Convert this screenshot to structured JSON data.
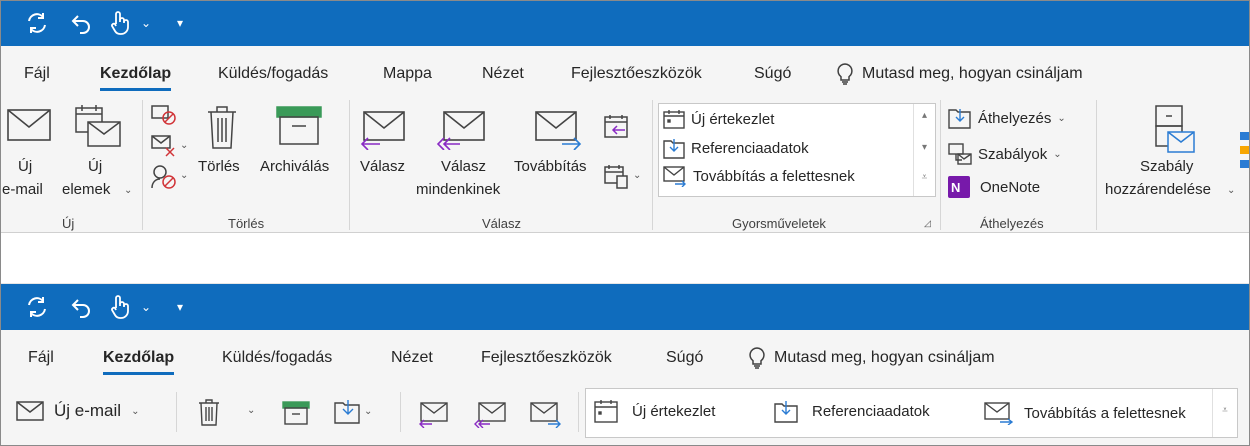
{
  "colors": {
    "brand": "#0f6cbd",
    "purple": "#8a2bc4",
    "blue": "#2b7cd3",
    "red": "#d13438",
    "green": "#3a9a58"
  },
  "top": {
    "qat": {
      "icons": [
        "sync-icon",
        "undo-icon",
        "touch-mode-icon",
        "customize-qat-icon"
      ],
      "dropdown": "⌄",
      "more": "▾"
    },
    "tabs": [
      "Fájl",
      "Kezdőlap",
      "Küldés/fogadás",
      "Mappa",
      "Nézet",
      "Fejlesztőeszközök",
      "Súgó"
    ],
    "active_tab": "Kezdőlap",
    "tell_me": "Mutasd meg, hogyan csináljam",
    "groups": {
      "new": {
        "label": "Új",
        "new_email_l1": "Új",
        "new_email_l2": "e-mail",
        "new_items_l1": "Új",
        "new_items_l2": "elemek"
      },
      "delete": {
        "label": "Törlés",
        "delete": "Törlés",
        "archive": "Archiválás"
      },
      "respond": {
        "label": "Válasz",
        "reply": "Válasz",
        "reply_all_l1": "Válasz",
        "reply_all_l2": "mindenkinek",
        "forward": "Továbbítás"
      },
      "quick_steps": {
        "label": "Gyorsműveletek",
        "items": [
          "Új értekezlet",
          "Referenciaadatok",
          "Továbbítás a felettesnek"
        ]
      },
      "move": {
        "label": "Áthelyezés",
        "move": "Áthelyezés",
        "rules": "Szabályok",
        "onenote": "OneNote"
      },
      "tags": {
        "assign_l1": "Szabály",
        "assign_l2": "hozzárendelése"
      }
    }
  },
  "bottom": {
    "tabs": [
      "Fájl",
      "Kezdőlap",
      "Küldés/fogadás",
      "Nézet",
      "Fejlesztőeszközök",
      "Súgó"
    ],
    "active_tab": "Kezdőlap",
    "tell_me": "Mutasd meg, hogyan csináljam",
    "new_email": "Új e-mail",
    "quick_steps": [
      "Új értekezlet",
      "Referenciaadatok",
      "Továbbítás a felettesnek"
    ]
  }
}
